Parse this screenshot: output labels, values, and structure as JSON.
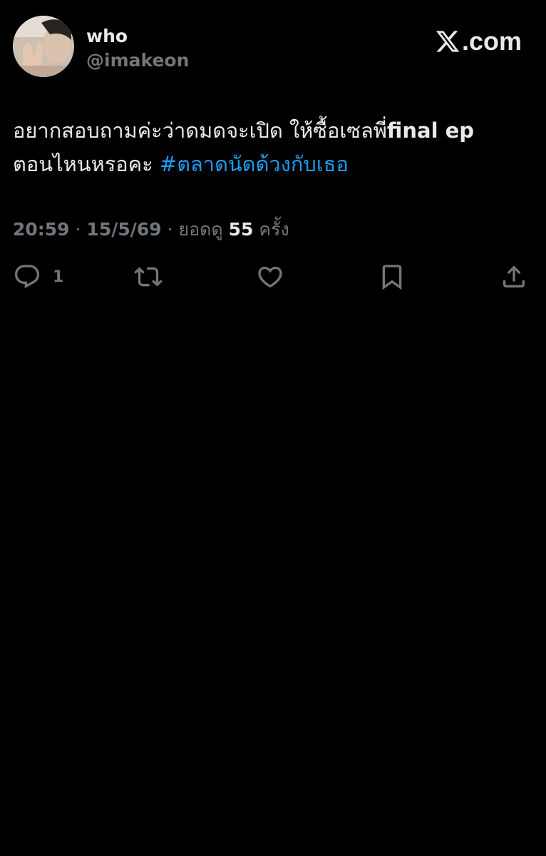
{
  "author": {
    "name": "who",
    "handle": "@imakeon",
    "avatar_icon": "avatar-photo"
  },
  "brand": {
    "text": ".com",
    "icon": "x-logo-icon"
  },
  "tweet": {
    "line1_regular": "อยากสอบถามค่ะว่าดมดจะเปิด ให้ซื้อเซลพี่",
    "line1_bold": "final ep",
    "line2_regular": "ตอนไหนหรอคะ ",
    "hashtag": "#ตลาดนัดด้วงกับเธอ"
  },
  "meta": {
    "time": "20:59",
    "date": "15/5/69",
    "sep": " · ",
    "views_label": "ยอดดู",
    "views_count": "55",
    "views_unit": "ครั้ง"
  },
  "actions": {
    "reply_count": "1",
    "icons": [
      "reply-icon",
      "retweet-icon",
      "like-icon",
      "bookmark-icon",
      "share-icon"
    ]
  },
  "colors": {
    "background": "#000000",
    "text": "#e7e9ea",
    "muted": "#71767b",
    "accent": "#1d9bf0"
  }
}
